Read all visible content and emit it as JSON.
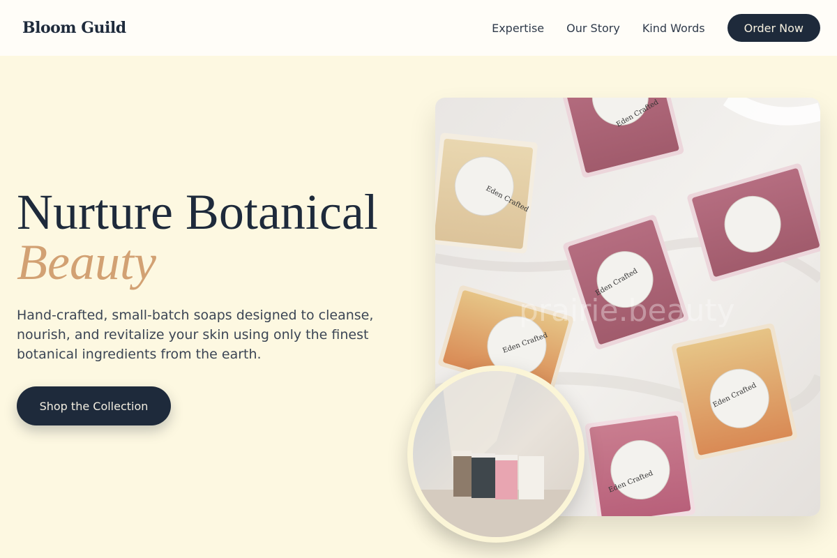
{
  "brand": {
    "name": "Bloom Guild"
  },
  "nav": {
    "links": [
      "Expertise",
      "Our Story",
      "Kind Words"
    ],
    "cta": "Order Now"
  },
  "hero": {
    "title_line1": "Nurture Botanical",
    "title_accent": "Beauty",
    "description": "Hand-crafted, small-batch soaps designed to cleanse, nourish, and revitalize your skin using only the finest botanical ingredients from the earth.",
    "button": "Shop the Collection"
  },
  "images": {
    "soap_label": "Eden Crafted",
    "watermark": "prairie.beauty"
  },
  "colors": {
    "navy": "#1e2a3b",
    "accent": "#d2a173",
    "background": "#fdf8e1"
  }
}
